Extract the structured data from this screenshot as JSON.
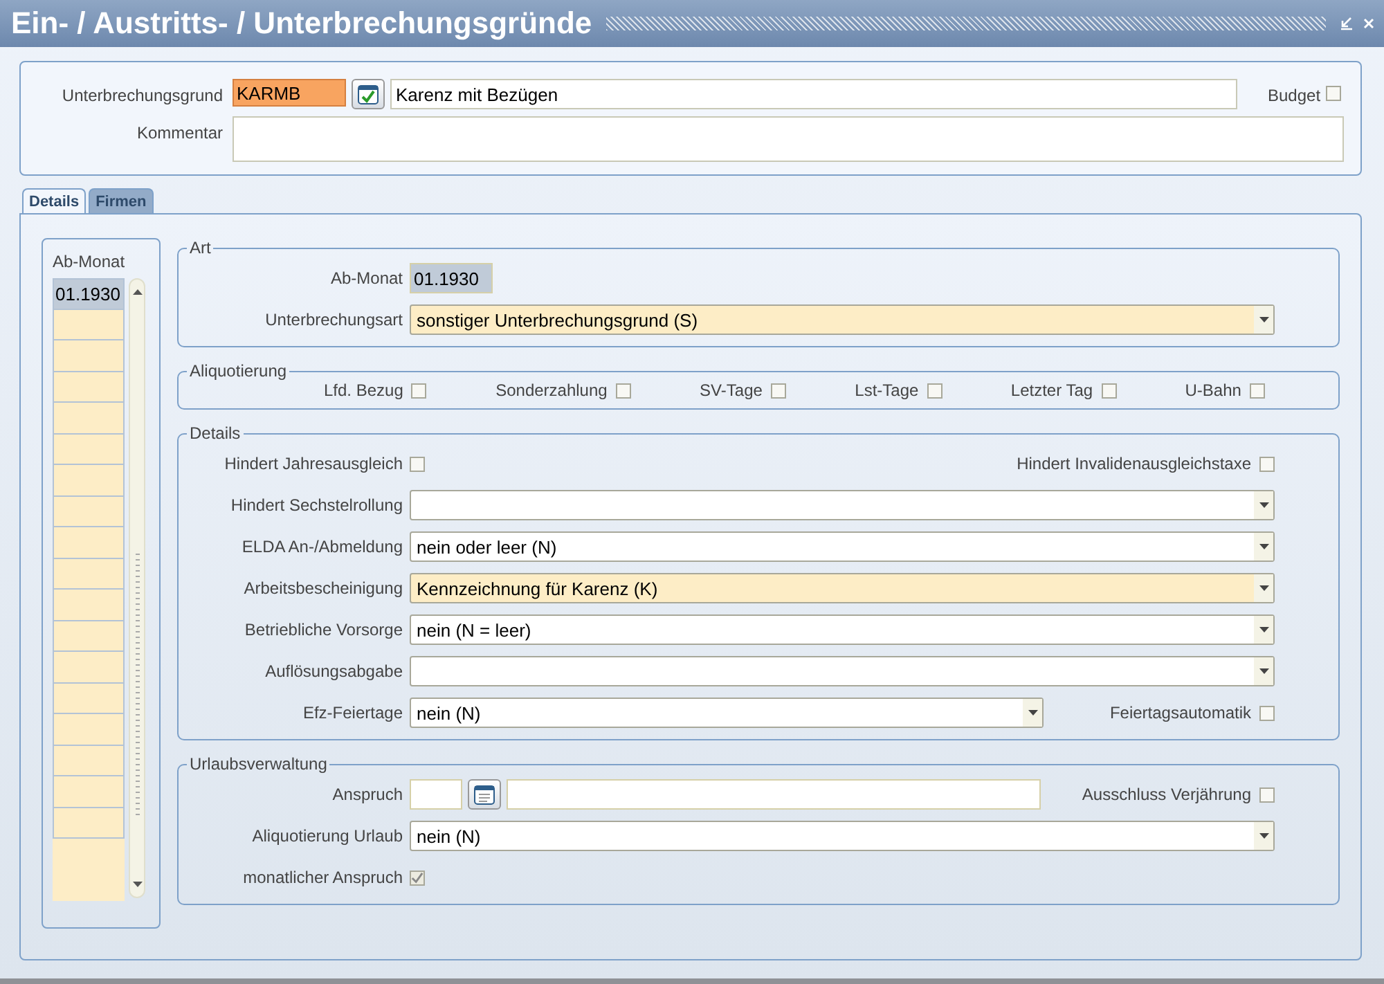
{
  "window": {
    "title": "Ein- / Austritts- / Unterbrechungsgründe"
  },
  "header": {
    "code_label": "Unterbrechungsgrund",
    "code": "KARMB",
    "description": "Karenz mit Bezügen",
    "budget": {
      "label": "Budget",
      "checked": false
    },
    "comment_label": "Kommentar"
  },
  "tabs": [
    {
      "label": "Details",
      "selected": true
    },
    {
      "label": "Firmen",
      "selected": false
    }
  ],
  "month_list": {
    "heading": "Ab-Monat",
    "rows": [
      {
        "value": "01.1930",
        "selected": true
      }
    ]
  },
  "art": {
    "title": "Art",
    "rows": [
      {
        "label": "Ab-Monat",
        "kind": "readonly",
        "value": "01.1930"
      },
      {
        "label": "Unterbrechungsart",
        "kind": "dropdown",
        "value": "sonstiger Unterbrechungsgrund (S)",
        "highlighted": true
      }
    ]
  },
  "aliquotierung": {
    "title": "Aliquotierung",
    "items": [
      {
        "label": "Lfd. Bezug",
        "checked": false
      },
      {
        "label": "Sonderzahlung",
        "checked": false
      },
      {
        "label": "SV-Tage",
        "checked": false
      },
      {
        "label": "Lst-Tage",
        "checked": false
      },
      {
        "label": "Letzter Tag",
        "checked": false
      },
      {
        "label": "U-Bahn",
        "checked": false
      }
    ]
  },
  "details": {
    "title": "Details",
    "rows": [
      {
        "label": "Hindert Jahresausgleich",
        "kind": "checkbox",
        "checked": false,
        "side": {
          "label": "Hindert Invalidenausgleichstaxe",
          "checked": false
        }
      },
      {
        "label": "Hindert Sechstelrollung",
        "kind": "dropdown",
        "highlighted": false
      },
      {
        "label": "ELDA An-/Abmeldung",
        "kind": "dropdown",
        "value": "nein oder leer (N)",
        "highlighted": false
      },
      {
        "label": "Arbeitsbescheinigung",
        "kind": "dropdown",
        "value": "Kennzeichnung für Karenz (K)",
        "highlighted": true
      },
      {
        "label": "Betriebliche Vorsorge",
        "kind": "dropdown",
        "value": "nein (N = leer)",
        "highlighted": false
      },
      {
        "label": "Auflösungsabgabe",
        "kind": "dropdown",
        "highlighted": false
      },
      {
        "label": "Efz-Feiertage",
        "kind": "dropdown",
        "value": "nein (N)",
        "highlighted": false,
        "side": {
          "label": "Feiertagsautomatik",
          "checked": false
        }
      }
    ]
  },
  "urlaub": {
    "title": "Urlaubsverwaltung",
    "rows": [
      {
        "label": "Anspruch",
        "kind": "lookup",
        "side": {
          "label": "Ausschluss Verjährung",
          "checked": false
        }
      },
      {
        "label": "Aliquotierung Urlaub",
        "kind": "dropdown",
        "value": "nein (N)",
        "highlighted": false
      },
      {
        "label": "monatlicher Anspruch",
        "kind": "checkbox",
        "checked": true
      }
    ]
  }
}
